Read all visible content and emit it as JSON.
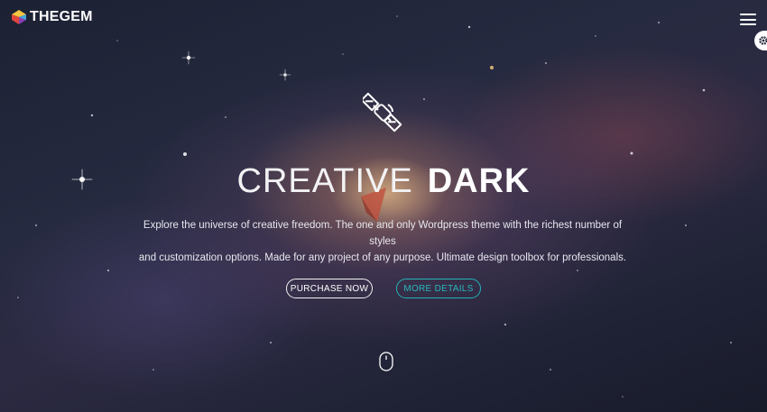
{
  "brand": {
    "name": "THEGEM"
  },
  "header": {
    "menu_icon": "hamburger-icon",
    "settings_icon": "gear-icon"
  },
  "hero": {
    "icon": "satellite-icon",
    "title_light": "CREATIVE",
    "title_bold": "DARK",
    "description_line1": "Explore the universe of creative freedom. The one and only Wordpress theme with the richest number of styles",
    "description_line2": "and customization options. Made for any project of any purpose. Ultimate design toolbox for professionals.",
    "buttons": {
      "purchase": "PURCHASE NOW",
      "details": "MORE DETAILS"
    },
    "scroll_icon": "mouse-scroll-icon"
  },
  "colors": {
    "accent_teal": "#2bb7bd",
    "background": "#1f2235",
    "text": "#ffffff"
  }
}
